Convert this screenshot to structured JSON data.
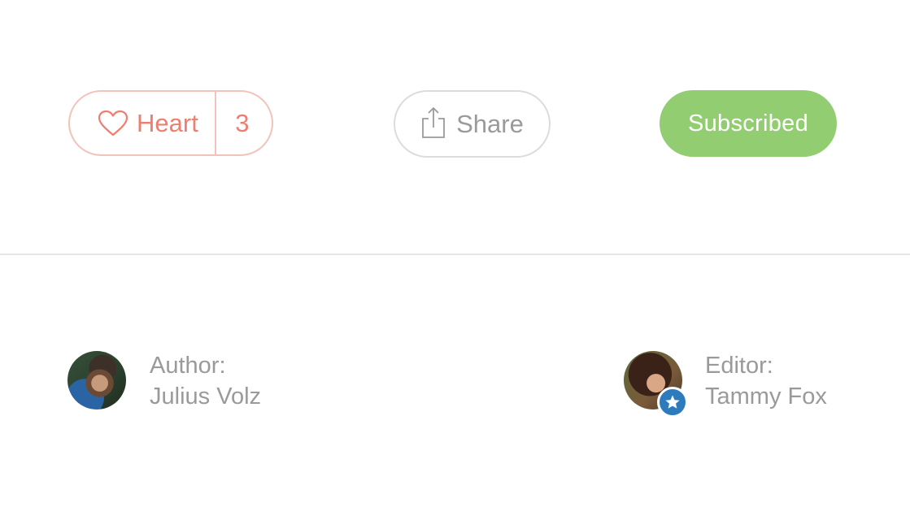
{
  "actions": {
    "heart": {
      "label": "Heart",
      "count": "3"
    },
    "share": {
      "label": "Share"
    },
    "subscribe": {
      "label": "Subscribed"
    }
  },
  "people": {
    "author": {
      "role": "Author:",
      "name": "Julius Volz"
    },
    "editor": {
      "role": "Editor:",
      "name": "Tammy Fox",
      "badge_icon": "star-icon"
    }
  },
  "colors": {
    "heart": "#ee7e70",
    "heart_border": "#f3c2bb",
    "share": "#9a9a9a",
    "subscribed_bg": "#92cd72",
    "editor_badge": "#2c7bbd"
  }
}
